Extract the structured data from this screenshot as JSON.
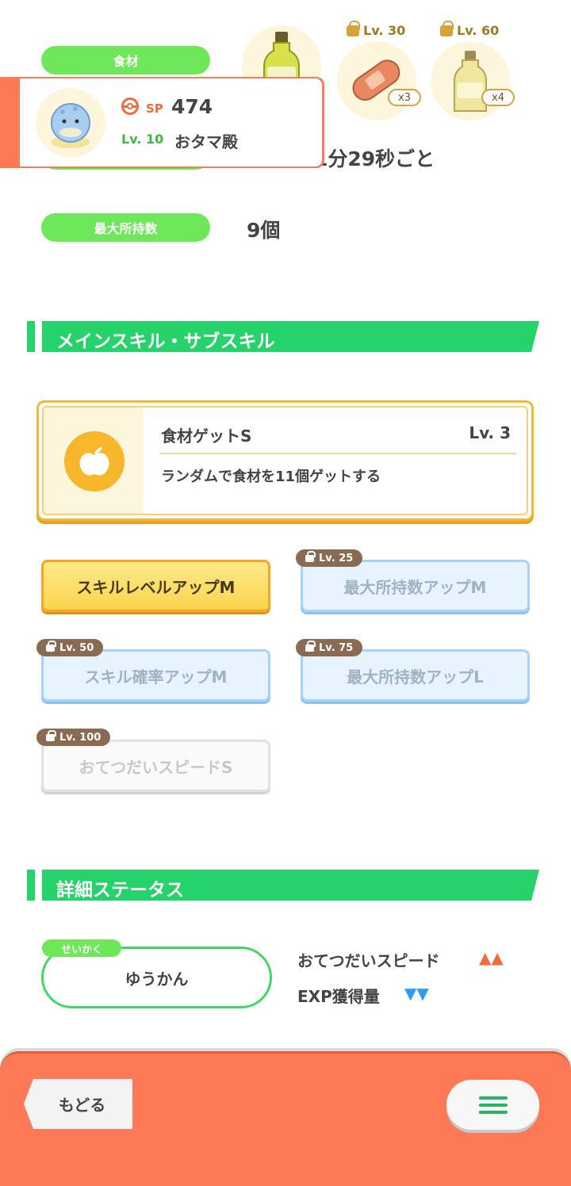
{
  "top_section": {
    "ingredient_label": "食材",
    "help_time_fragment": "1分29秒ごと",
    "max_carry_label": "最大所持数",
    "max_carry_value": "9個",
    "ingredients": [
      {
        "icon": "oil-bottle-icon",
        "qty": "",
        "lock_label": ""
      },
      {
        "icon": "sausage-icon",
        "qty": "x3",
        "lock_label": "Lv. 30"
      },
      {
        "icon": "oil-bottle-icon",
        "qty": "x4",
        "lock_label": "Lv. 60"
      }
    ]
  },
  "popup": {
    "sp_label": "SP",
    "sp_value": "474",
    "level": "Lv. 10",
    "name": "おタマ殿"
  },
  "skills_section": {
    "title": "メインスキル・サブスキル",
    "main_skill": {
      "name": "食材ゲットS",
      "level": "Lv. 3",
      "description": "ランダムで食材を11個ゲットする"
    },
    "subskills": [
      {
        "label": "スキルレベルアップM",
        "lock": ""
      },
      {
        "label": "最大所持数アップM",
        "lock": "Lv. 25"
      },
      {
        "label": "スキル確率アップM",
        "lock": "Lv. 50"
      },
      {
        "label": "最大所持数アップL",
        "lock": "Lv. 75"
      },
      {
        "label": "おてつだいスピードS",
        "lock": "Lv. 100"
      }
    ]
  },
  "details_section": {
    "title": "詳細ステータス",
    "nature_tag": "せいかく",
    "nature_value": "ゆうかん",
    "effects": [
      {
        "label": "おてつだいスピード",
        "arrows": "▲▲",
        "color": "#f26a3d"
      },
      {
        "label": "EXP獲得量",
        "arrows": "▼▼",
        "color": "#2a9df4"
      }
    ]
  },
  "bottom_bar": {
    "back_label": "もどる"
  },
  "colors": {
    "green": "#26d36a",
    "pill_green": "#6ee75a",
    "orange": "#fe7a56",
    "gold": "#f6b631"
  }
}
